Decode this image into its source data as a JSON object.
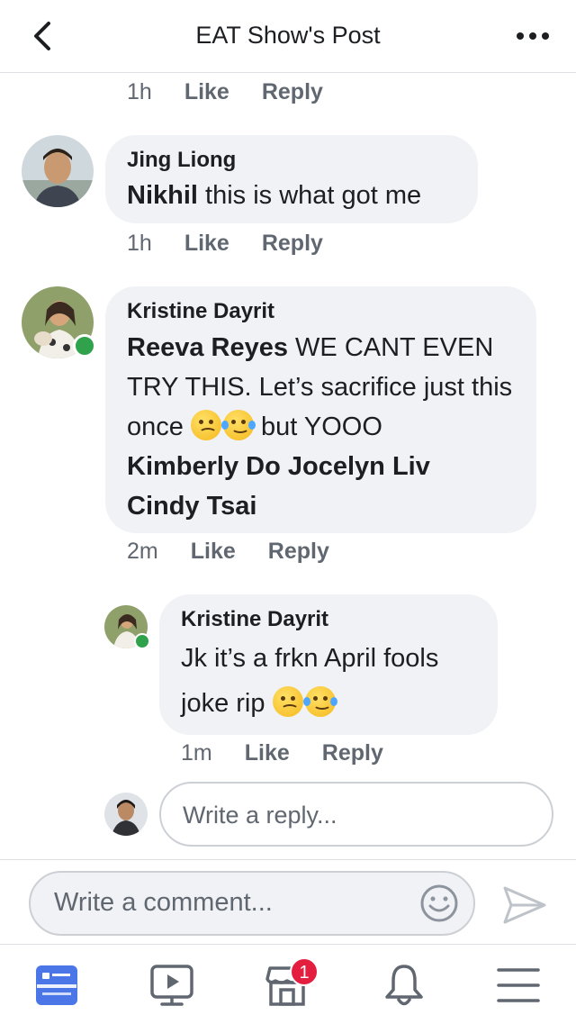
{
  "header": {
    "title": "EAT Show's Post",
    "back_icon": "chevron-left-icon",
    "more_icon": "more-dots-icon"
  },
  "top_meta": {
    "time": "1h",
    "like": "Like",
    "reply": "Reply"
  },
  "comments": [
    {
      "author": "Jing Liong",
      "mention": "Nikhil",
      "text": " this is what got me",
      "time": "1h",
      "like": "Like",
      "reply": "Reply"
    },
    {
      "author": "Kristine Dayrit",
      "mention": "Reeva Reyes",
      "text_line1": " WE CANT EVEN TRY THIS. Let’s sacrifice just this once ",
      "text_line2": " but YOOO",
      "mention2": "Kimberly Do",
      "mention3": "Jocelyn Liv",
      "mention4": "Cindy Tsai",
      "time": "2m",
      "like": "Like",
      "reply": "Reply",
      "online": true
    }
  ],
  "reply": {
    "author": "Kristine Dayrit",
    "text": "Jk it’s a frkn April fools joke rip ",
    "time": "1m",
    "like": "Like",
    "reply": "Reply",
    "online": true
  },
  "reply_input": {
    "placeholder": "Write a reply..."
  },
  "comment_bar": {
    "placeholder": "Write a comment...",
    "emoji_icon": "smiley-icon",
    "send_icon": "send-icon"
  },
  "tabbar": {
    "items": [
      "news-feed-icon",
      "watch-icon",
      "marketplace-icon",
      "notifications-icon",
      "menu-icon"
    ],
    "marketplace_badge": "1"
  },
  "colors": {
    "accent": "#4a76e8",
    "online": "#31a24c",
    "badge": "#e41e3f",
    "bubble": "#f0f2f5"
  }
}
